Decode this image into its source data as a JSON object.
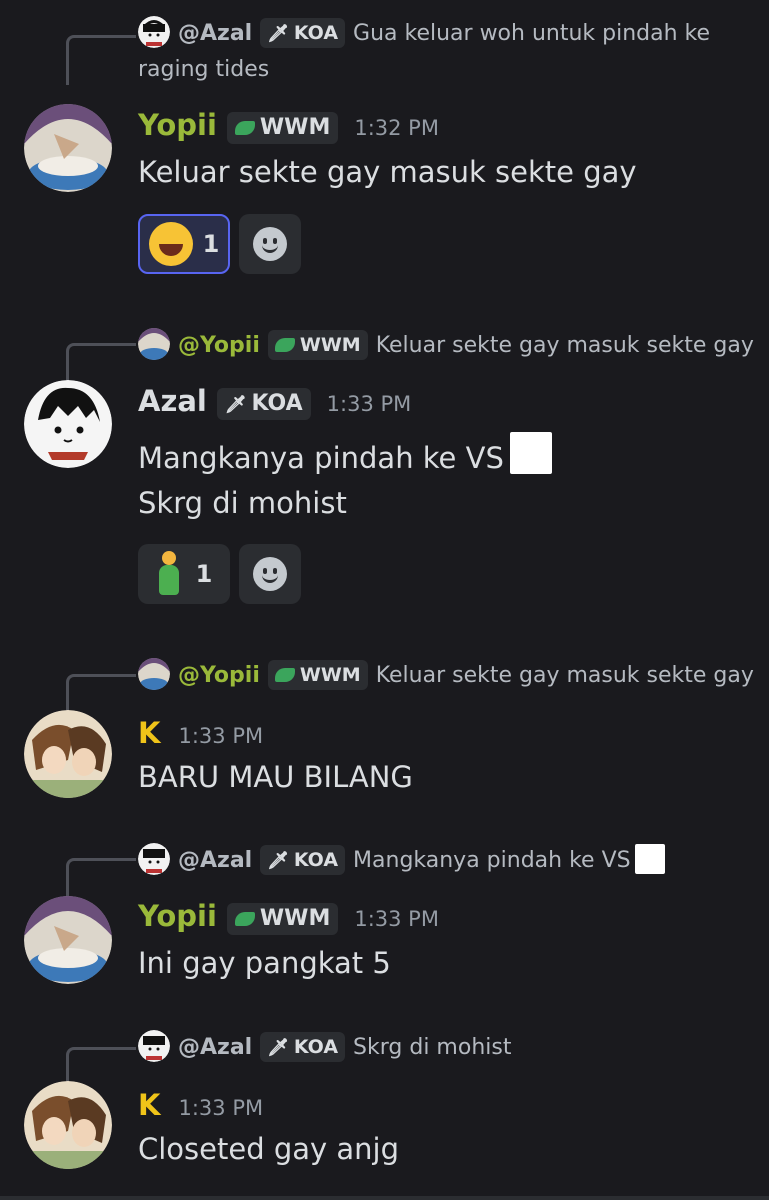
{
  "messages": [
    {
      "reply": {
        "name": "@Azal",
        "badge": "KOA",
        "text": "Gua keluar woh untuk pindah ke raging tides"
      },
      "author": {
        "name": "Yopii",
        "badge": "WWM",
        "color": "#9ab93a"
      },
      "time": "1:32 PM",
      "lines": [
        "Keluar sekte gay masuk sekte gay"
      ],
      "reactions": [
        {
          "icon": "laughing-emoji",
          "count": "1"
        }
      ]
    },
    {
      "reply": {
        "name": "@Yopii",
        "badge": "WWM",
        "text": "Keluar sekte gay masuk sekte gay"
      },
      "author": {
        "name": "Azal",
        "badge": "KOA",
        "color": "#dbdee1"
      },
      "time": "1:33 PM",
      "lines": [
        "Mangkanya pindah ke VS",
        "Skrg di mohist"
      ],
      "reactions": [
        {
          "icon": "person-emoji",
          "count": "1"
        }
      ]
    },
    {
      "reply": {
        "name": "@Yopii",
        "badge": "WWM",
        "text": "Keluar sekte gay masuk sekte gay"
      },
      "author": {
        "name": "K",
        "badge": "",
        "color": "#f0c419"
      },
      "time": "1:33 PM",
      "lines": [
        "BARU MAU BILANG"
      ]
    },
    {
      "reply": {
        "name": "@Azal",
        "badge": "KOA",
        "text": "Mangkanya pindah ke VS"
      },
      "author": {
        "name": "Yopii",
        "badge": "WWM",
        "color": "#9ab93a"
      },
      "time": "1:33 PM",
      "lines": [
        "Ini gay pangkat 5"
      ]
    },
    {
      "reply": {
        "name": "@Azal",
        "badge": "KOA",
        "text": "Skrg di mohist"
      },
      "author": {
        "name": "K",
        "badge": "",
        "color": "#f0c419"
      },
      "time": "1:33 PM",
      "lines": [
        "Closeted gay anjg"
      ]
    }
  ],
  "colors": {
    "background": "#1a1a1e",
    "wwm_reply_name": "#9ab93a",
    "reaction_active_border": "#5865f2"
  }
}
